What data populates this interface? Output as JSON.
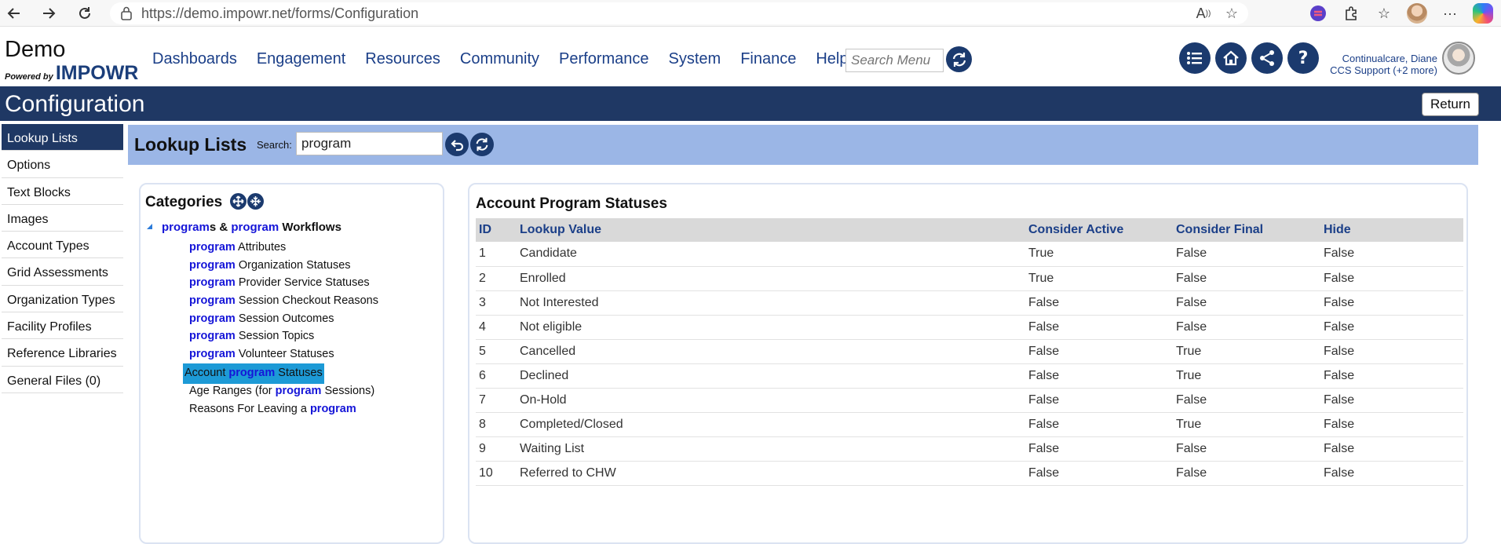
{
  "browser": {
    "url": "https://demo.impowr.net/forms/Configuration"
  },
  "header": {
    "logo_demo": "Demo",
    "logo_powered": "Powered by",
    "logo_impowr": "IMPOWR",
    "nav": [
      "Dashboards",
      "Engagement",
      "Resources",
      "Community",
      "Performance",
      "System",
      "Finance",
      "Help"
    ],
    "search_placeholder": "Search Menu",
    "user_name": "Continualcare, Diane",
    "user_role": "CCS Support (+2 more)"
  },
  "title_bar": {
    "title": "Configuration",
    "return_label": "Return"
  },
  "sidebar": {
    "items": [
      "Lookup Lists",
      "Options",
      "Text Blocks",
      "Images",
      "Account Types",
      "Grid Assessments",
      "Organization Types",
      "Facility Profiles",
      "Reference Libraries",
      "General Files (0)"
    ],
    "active_index": 0
  },
  "lookup": {
    "title": "Lookup Lists",
    "search_label": "Search:",
    "search_value": "program"
  },
  "categories": {
    "title": "Categories",
    "root": {
      "part1": "program",
      "part2": "s & ",
      "part3": "program",
      "part4": " Workflows"
    },
    "items": [
      {
        "pre": "",
        "hl": "program",
        "post": " Attributes"
      },
      {
        "pre": "",
        "hl": "program",
        "post": " Organization Statuses"
      },
      {
        "pre": "",
        "hl": "program",
        "post": " Provider Service Statuses"
      },
      {
        "pre": "",
        "hl": "program",
        "post": " Session Checkout Reasons"
      },
      {
        "pre": "",
        "hl": "program",
        "post": " Session Outcomes"
      },
      {
        "pre": "",
        "hl": "program",
        "post": " Session Topics"
      },
      {
        "pre": "",
        "hl": "program",
        "post": " Volunteer Statuses"
      },
      {
        "pre": "Account ",
        "hl": "program",
        "post": " Statuses"
      },
      {
        "pre": "Age Ranges (for ",
        "hl": "program",
        "post": " Sessions)"
      },
      {
        "pre": "Reasons For Leaving a ",
        "hl": "program",
        "post": ""
      }
    ],
    "selected_index": 7
  },
  "status_table": {
    "title": "Account Program Statuses",
    "headers": [
      "ID",
      "Lookup Value",
      "Consider Active",
      "Consider Final",
      "Hide"
    ],
    "rows": [
      [
        "1",
        "Candidate",
        "True",
        "False",
        "False"
      ],
      [
        "2",
        "Enrolled",
        "True",
        "False",
        "False"
      ],
      [
        "3",
        "Not Interested",
        "False",
        "False",
        "False"
      ],
      [
        "4",
        "Not eligible",
        "False",
        "False",
        "False"
      ],
      [
        "5",
        "Cancelled",
        "False",
        "True",
        "False"
      ],
      [
        "6",
        "Declined",
        "False",
        "True",
        "False"
      ],
      [
        "7",
        "On-Hold",
        "False",
        "False",
        "False"
      ],
      [
        "8",
        "Completed/Closed",
        "False",
        "True",
        "False"
      ],
      [
        "9",
        "Waiting List",
        "False",
        "False",
        "False"
      ],
      [
        "10",
        "Referred to CHW",
        "False",
        "False",
        "False"
      ]
    ]
  },
  "icons": {
    "back": "arrow-left-icon",
    "forward": "arrow-right-icon",
    "reload": "reload-icon",
    "lock": "lock-icon",
    "read_aloud": "read-aloud-icon",
    "favorite": "star-icon",
    "extensions": "puzzle-icon",
    "collections": "favorites-icon",
    "more": "more-icon",
    "menu_list": "list-icon",
    "home": "home-icon",
    "share": "share-icon",
    "help": "help-icon",
    "refresh": "refresh-icon",
    "undo": "undo-icon",
    "expand_all": "expand-icon",
    "collapse_all": "collapse-icon"
  },
  "colors": {
    "brand_dark": "#1f3864",
    "band": "#9bb6e6",
    "link": "#1b3f88",
    "highlight": "#1515d8",
    "selection": "#1d9ad6"
  }
}
